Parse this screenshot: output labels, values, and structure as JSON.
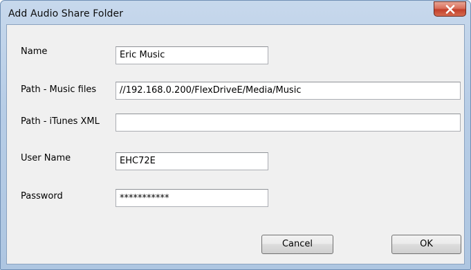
{
  "window": {
    "title": "Add Audio Share Folder",
    "close_icon": "close-x-icon"
  },
  "form": {
    "name_label": "Name",
    "name_value": "Eric Music",
    "music_path_label": "Path - Music files",
    "music_path_value": "//192.168.0.200/FlexDriveE/Media/Music",
    "itunes_path_label": "Path - iTunes XML",
    "itunes_path_value": "",
    "username_label": "User Name",
    "username_value": "EHC72E",
    "password_label": "Password",
    "password_value": "***********"
  },
  "buttons": {
    "cancel_label": "Cancel",
    "ok_label": "OK"
  },
  "colors": {
    "frame": "#b7cde6",
    "client": "#f0f0f0",
    "close_button": "#c7462f"
  }
}
